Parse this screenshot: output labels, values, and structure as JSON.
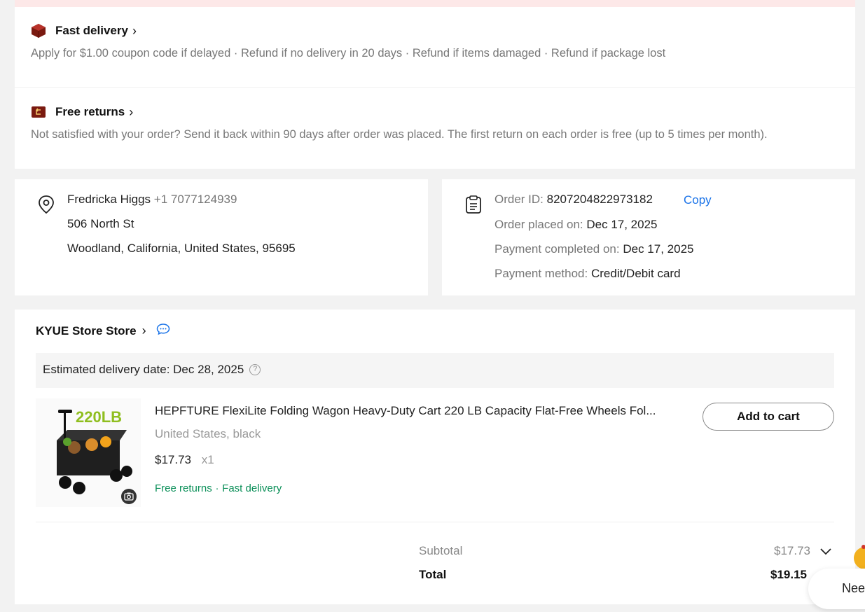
{
  "services": {
    "fast_delivery": {
      "title": "Fast delivery",
      "desc": "Apply for $1.00 coupon code if delayed · Refund if no delivery in 20 days · Refund if items damaged · Refund if package lost"
    },
    "free_returns": {
      "title": "Free returns",
      "desc": "Not satisfied with your order? Send it back within 90 days after order was placed. The first return on each order is free (up to 5 times per month)."
    }
  },
  "address": {
    "name": "Fredricka Higgs",
    "phone": "+1 7077124939",
    "street": "506 North St",
    "city_line": "Woodland, California, United States, 95695"
  },
  "order": {
    "id_label": "Order ID:",
    "id_value": "8207204822973182",
    "copy_label": "Copy",
    "placed_label": "Order placed on:",
    "placed_value": "Dec 17, 2025",
    "paid_label": "Payment completed on:",
    "paid_value": "Dec 17, 2025",
    "method_label": "Payment method:",
    "method_value": "Credit/Debit card"
  },
  "store": {
    "name": "KYUE Store Store",
    "est_label": "Estimated delivery date:",
    "est_value": "Dec 28, 2025"
  },
  "product": {
    "title": "HEPFTURE FlexiLite Folding Wagon Heavy-Duty Cart 220 LB Capacity Flat-Free Wheels Fol...",
    "variant": "United States, black",
    "price": "$17.73",
    "qty": "x1",
    "tag1": "Free returns",
    "tag_sep": "·",
    "tag2": "Fast delivery",
    "image_text": "220LB",
    "add_to_cart": "Add to cart"
  },
  "summary": {
    "subtotal_label": "Subtotal",
    "subtotal_value": "$17.73",
    "total_label": "Total",
    "total_value": "$19.15"
  },
  "chat": {
    "label": "Nee"
  },
  "colors": {
    "accent_blue": "#1a73e8",
    "green": "#0a8f58",
    "brand_dark": "#7a1a10"
  }
}
